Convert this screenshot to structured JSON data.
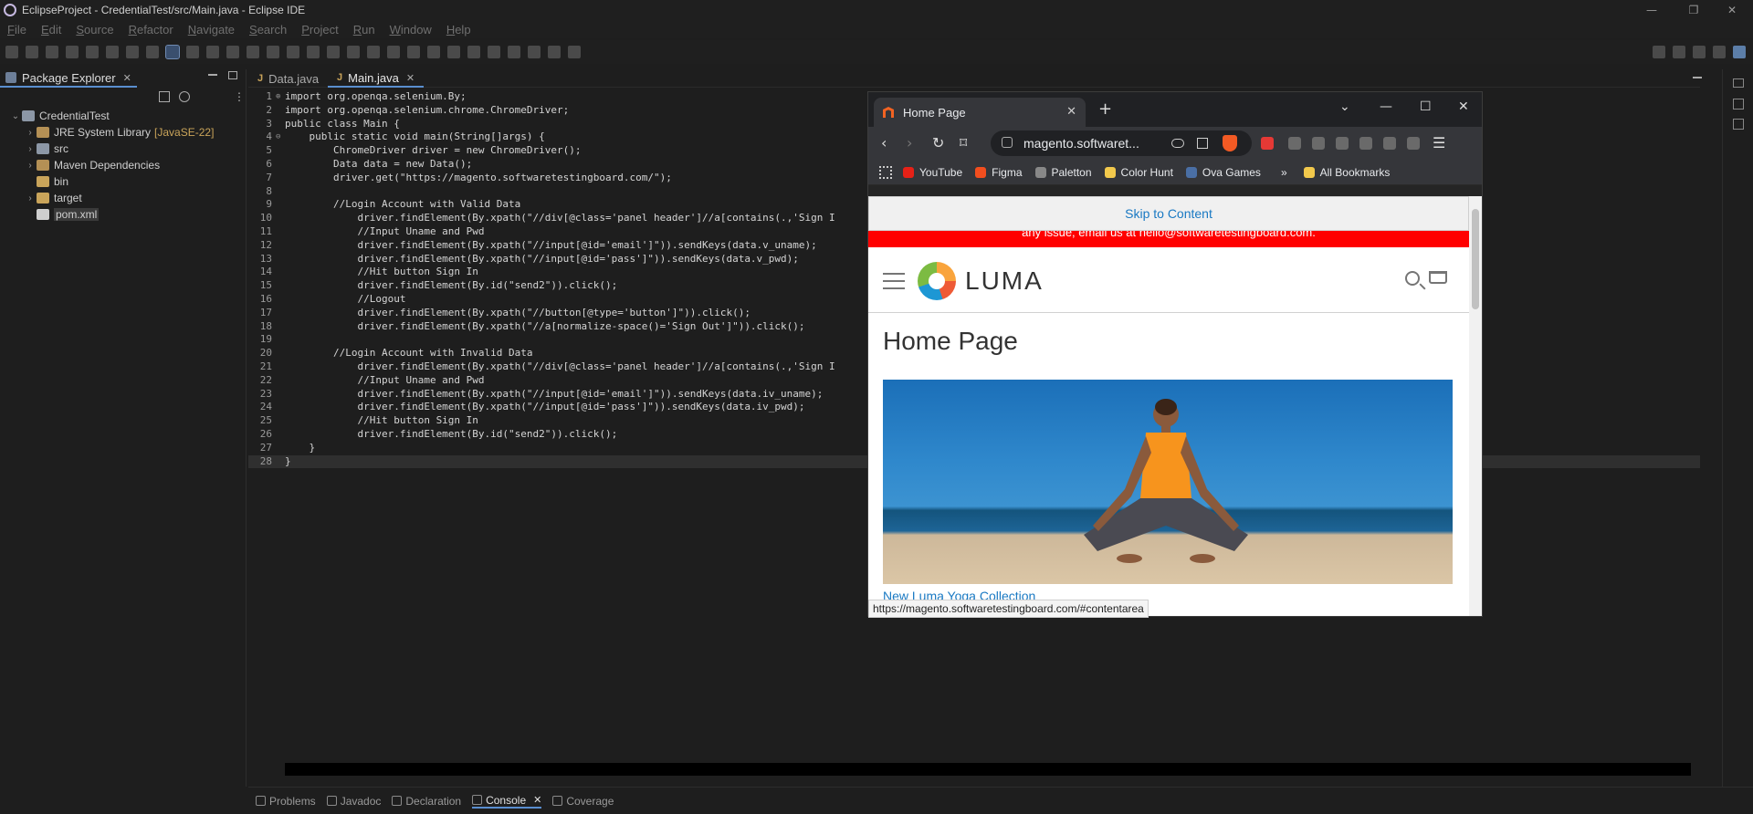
{
  "window": {
    "title": "EclipseProject - CredentialTest/src/Main.java - Eclipse IDE",
    "controls": [
      "—",
      "❐",
      "✕"
    ]
  },
  "menu": [
    "File",
    "Edit",
    "Source",
    "Refactor",
    "Navigate",
    "Search",
    "Project",
    "Run",
    "Window",
    "Help"
  ],
  "package_explorer": {
    "tab_label": "Package Explorer",
    "tree": [
      {
        "label": "CredentialTest",
        "sub": "",
        "depth": 0,
        "expanded": true,
        "icon_color": "#8c97a6"
      },
      {
        "label": "JRE System Library",
        "sub": "[JavaSE-22]",
        "depth": 1,
        "expanded": false,
        "icon_color": "#b49055"
      },
      {
        "label": "src",
        "sub": "",
        "depth": 1,
        "expanded": false,
        "icon_color": "#8c97a6"
      },
      {
        "label": "Maven Dependencies",
        "sub": "",
        "depth": 1,
        "expanded": false,
        "icon_color": "#b49055"
      },
      {
        "label": "bin",
        "sub": "",
        "depth": 1,
        "expanded": null,
        "icon_color": "#c9a45a"
      },
      {
        "label": "target",
        "sub": "",
        "depth": 1,
        "expanded": false,
        "icon_color": "#c9a45a"
      },
      {
        "label": "pom.xml",
        "sub": "",
        "depth": 1,
        "expanded": null,
        "icon_color": "#cfcfcf",
        "selected": true
      }
    ]
  },
  "editor": {
    "tabs": [
      {
        "label": "Data.java",
        "active": false
      },
      {
        "label": "Main.java",
        "active": true
      }
    ],
    "lines": [
      {
        "n": "1",
        "m": "⊕",
        "t": "import org.openqa.selenium.By;"
      },
      {
        "n": "2",
        "m": "",
        "t": "import org.openqa.selenium.chrome.ChromeDriver;"
      },
      {
        "n": "3",
        "m": "",
        "t": "public class Main {"
      },
      {
        "n": "4",
        "m": "⊖",
        "t": "    public static void main(String[]args) {"
      },
      {
        "n": "5",
        "m": "",
        "t": "        ChromeDriver driver = new ChromeDriver();"
      },
      {
        "n": "6",
        "m": "",
        "t": "        Data data = new Data();"
      },
      {
        "n": "7",
        "m": "",
        "t": "        driver.get(\"https://magento.softwaretestingboard.com/\");"
      },
      {
        "n": "8",
        "m": "",
        "t": ""
      },
      {
        "n": "9",
        "m": "",
        "t": "        //Login Account with Valid Data"
      },
      {
        "n": "10",
        "m": "",
        "t": "            driver.findElement(By.xpath(\"//div[@class='panel header']//a[contains(.,'Sign I"
      },
      {
        "n": "11",
        "m": "",
        "t": "            //Input Uname and Pwd"
      },
      {
        "n": "12",
        "m": "",
        "t": "            driver.findElement(By.xpath(\"//input[@id='email']\")).sendKeys(data.v_uname);"
      },
      {
        "n": "13",
        "m": "",
        "t": "            driver.findElement(By.xpath(\"//input[@id='pass']\")).sendKeys(data.v_pwd);"
      },
      {
        "n": "14",
        "m": "",
        "t": "            //Hit button Sign In"
      },
      {
        "n": "15",
        "m": "",
        "t": "            driver.findElement(By.id(\"send2\")).click();"
      },
      {
        "n": "16",
        "m": "",
        "t": "            //Logout"
      },
      {
        "n": "17",
        "m": "",
        "t": "            driver.findElement(By.xpath(\"//button[@type='button']\")).click();"
      },
      {
        "n": "18",
        "m": "",
        "t": "            driver.findElement(By.xpath(\"//a[normalize-space()='Sign Out']\")).click();"
      },
      {
        "n": "19",
        "m": "",
        "t": ""
      },
      {
        "n": "20",
        "m": "",
        "t": "        //Login Account with Invalid Data"
      },
      {
        "n": "21",
        "m": "",
        "t": "            driver.findElement(By.xpath(\"//div[@class='panel header']//a[contains(.,'Sign I"
      },
      {
        "n": "22",
        "m": "",
        "t": "            //Input Uname and Pwd"
      },
      {
        "n": "23",
        "m": "",
        "t": "            driver.findElement(By.xpath(\"//input[@id='email']\")).sendKeys(data.iv_uname);"
      },
      {
        "n": "24",
        "m": "",
        "t": "            driver.findElement(By.xpath(\"//input[@id='pass']\")).sendKeys(data.iv_pwd);"
      },
      {
        "n": "25",
        "m": "",
        "t": "            //Hit button Sign In"
      },
      {
        "n": "26",
        "m": "",
        "t": "            driver.findElement(By.id(\"send2\")).click();"
      },
      {
        "n": "27",
        "m": "",
        "t": "    }"
      },
      {
        "n": "28",
        "m": "",
        "t": "}",
        "current": true
      }
    ]
  },
  "bottom_tabs": [
    {
      "label": "Problems",
      "active": false
    },
    {
      "label": "Javadoc",
      "active": false
    },
    {
      "label": "Declaration",
      "active": false
    },
    {
      "label": "Console",
      "active": true
    },
    {
      "label": "Coverage",
      "active": false
    }
  ],
  "browser": {
    "tab_title": "Home Page",
    "address": "magento.softwaret...",
    "bookmarks": [
      {
        "label": "YouTube",
        "color": "#e62117"
      },
      {
        "label": "Figma",
        "color": "#f24e1e"
      },
      {
        "label": "Paletton",
        "color": "#888888"
      },
      {
        "label": "Color Hunt",
        "color": "#f2c94c"
      },
      {
        "label": "Ova Games",
        "color": "#4a6fa5"
      }
    ],
    "all_bookmarks": "All Bookmarks",
    "more_bookmarks": "»",
    "page": {
      "skip_link": "Skip to Content",
      "promo": "any issue, email us at hello@softwaretestingboard.com.",
      "logo_text": "LUMA",
      "title": "Home Page",
      "hero_link": "New Luma Yoga Collection",
      "status_url": "https://magento.softwaretestingboard.com/#contentarea"
    }
  },
  "colors": {
    "accent": "#5a8ecf",
    "luma_link": "#1979c3",
    "promo_red": "#ff0000"
  }
}
